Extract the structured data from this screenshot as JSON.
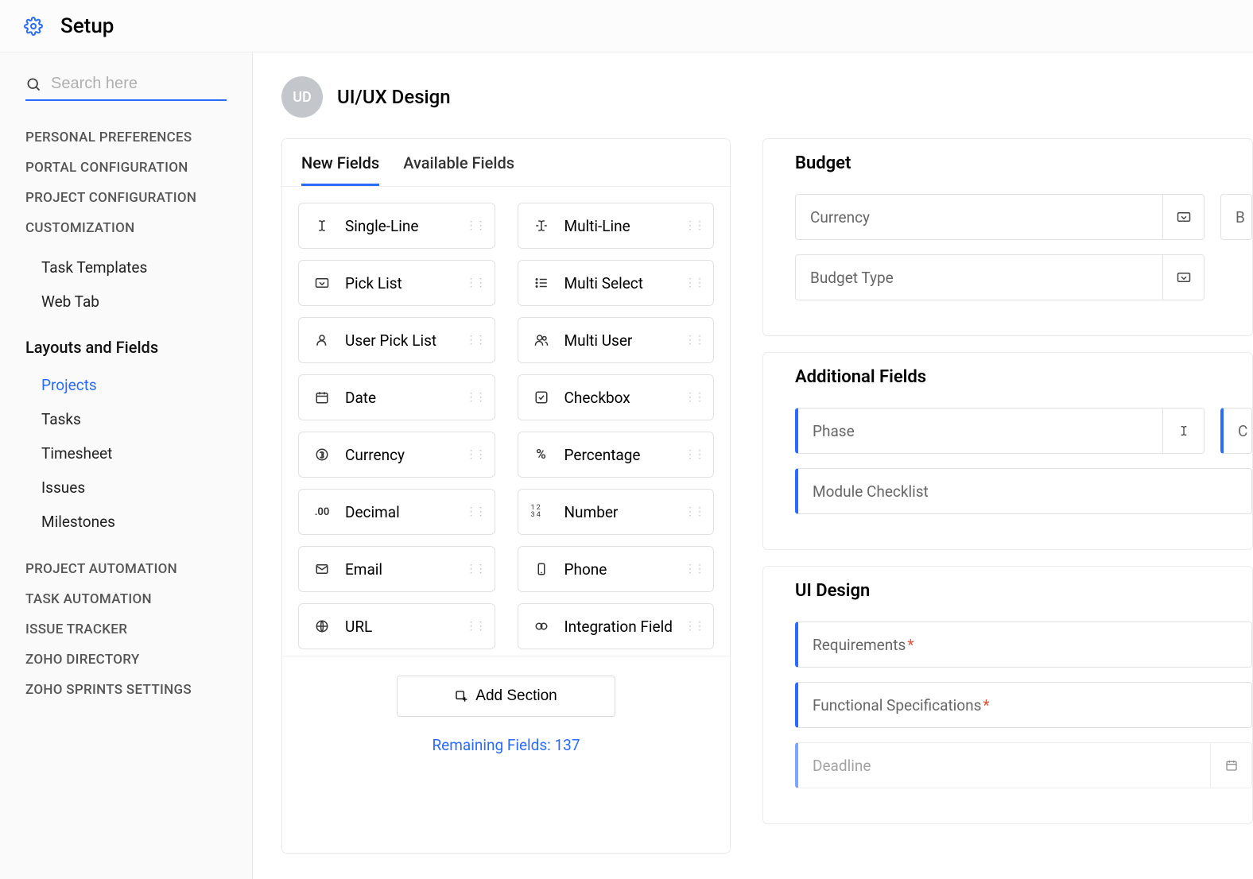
{
  "header": {
    "title": "Setup"
  },
  "sidebar": {
    "search_placeholder": "Search here",
    "sections": {
      "personal": "PERSONAL PREFERENCES",
      "portal": "PORTAL CONFIGURATION",
      "project_conf": "PROJECT CONFIGURATION",
      "customization": "CUSTOMIZATION",
      "layouts": "Layouts and Fields",
      "project_auto": "PROJECT AUTOMATION",
      "task_auto": "TASK AUTOMATION",
      "issue_tracker": "ISSUE TRACKER",
      "zoho_dir": "ZOHO DIRECTORY",
      "zoho_sprints": "ZOHO SPRINTS SETTINGS"
    },
    "customization_items": {
      "task_templates": "Task Templates",
      "web_tab": "Web Tab"
    },
    "layouts_items": {
      "projects": "Projects",
      "tasks": "Tasks",
      "timesheet": "Timesheet",
      "issues": "Issues",
      "milestones": "Milestones"
    }
  },
  "project": {
    "avatar_initials": "UD",
    "title": "UI/UX Design"
  },
  "tabs": {
    "new_fields": "New Fields",
    "available_fields": "Available Fields"
  },
  "field_types": {
    "single_line": "Single-Line",
    "multi_line": "Multi-Line",
    "pick_list": "Pick List",
    "multi_select": "Multi Select",
    "user_pick_list": "User Pick List",
    "multi_user": "Multi User",
    "date": "Date",
    "checkbox": "Checkbox",
    "currency": "Currency",
    "percentage": "Percentage",
    "decimal": "Decimal",
    "number": "Number",
    "email": "Email",
    "phone": "Phone",
    "url": "URL",
    "integration": "Integration Field"
  },
  "footer": {
    "add_section": "Add Section",
    "remaining": "Remaining Fields: 137"
  },
  "sections": {
    "budget": {
      "title": "Budget",
      "currency": "Currency",
      "budget_type": "Budget Type",
      "extra": "B"
    },
    "additional": {
      "title": "Additional Fields",
      "phase": "Phase",
      "module_checklist": "Module Checklist",
      "extra": "C"
    },
    "ui_design": {
      "title": "UI Design",
      "requirements": "Requirements",
      "functional_spec": "Functional Specifications",
      "deadline": "Deadline"
    }
  }
}
